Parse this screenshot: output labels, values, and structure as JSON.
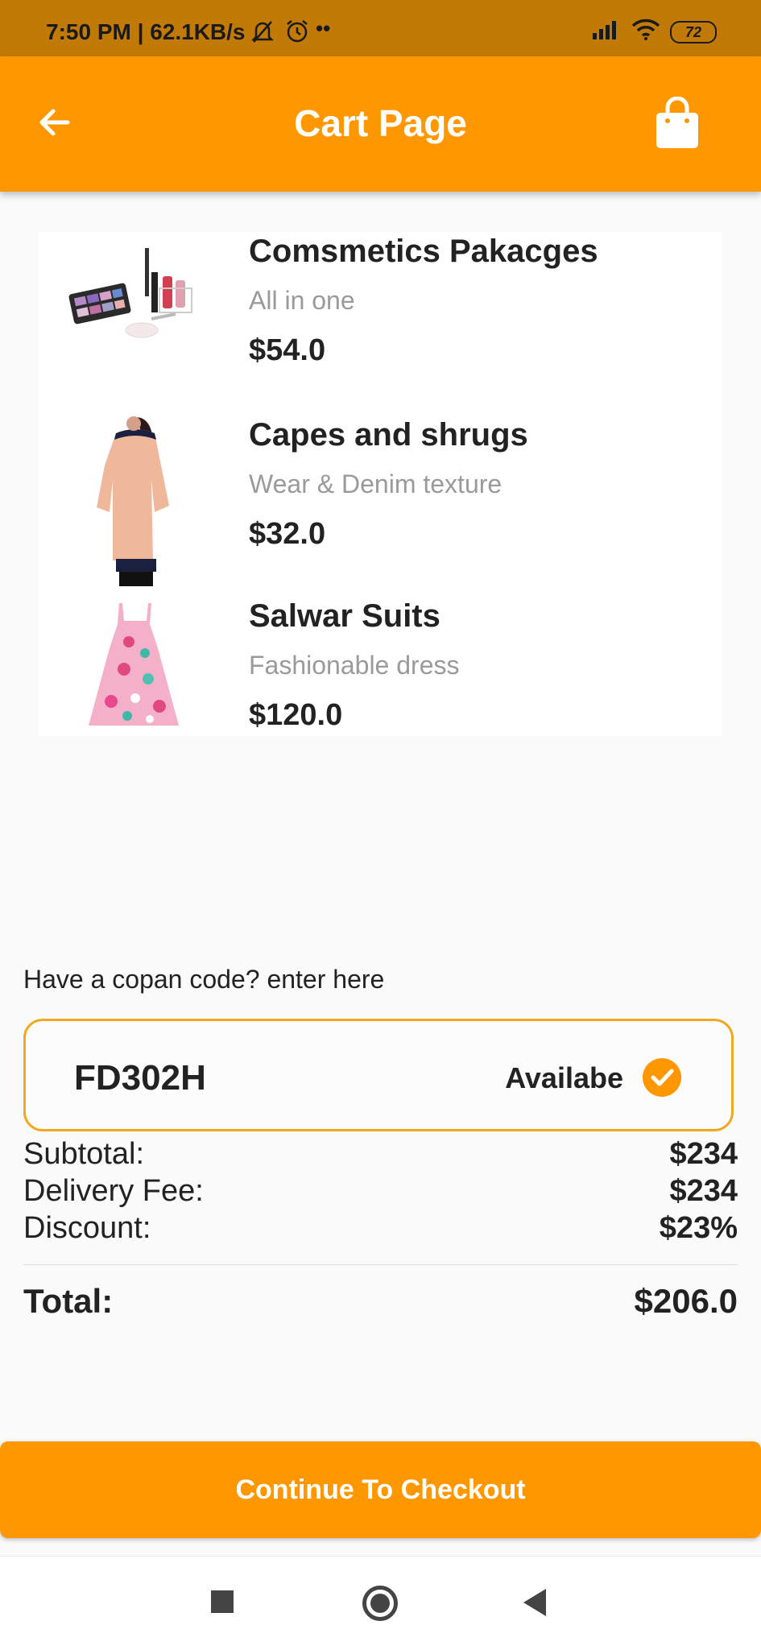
{
  "status_bar": {
    "time_speed": "7:50 PM | 62.1KB/s",
    "battery": "72"
  },
  "app_bar": {
    "title": "Cart Page"
  },
  "cart_items": [
    {
      "name": "Comsmetics Pakacges",
      "subtitle": "All in one",
      "price": "$54.0"
    },
    {
      "name": "Capes and shrugs",
      "subtitle": "Wear & Denim texture",
      "price": "$32.0"
    },
    {
      "name": "Salwar Suits",
      "subtitle": "Fashionable dress",
      "price": "$120.0"
    }
  ],
  "coupon": {
    "prompt": "Have a copan code? enter here",
    "code": "FD302H",
    "status": "Availabe"
  },
  "summary": {
    "subtotal_label": "Subtotal:",
    "subtotal_value": "$234",
    "delivery_label": "Delivery Fee:",
    "delivery_value": "$234",
    "discount_label": "Discount:",
    "discount_value": "$23%",
    "total_label": "Total:",
    "total_value": "$206.0"
  },
  "checkout_button": "Continue To Checkout",
  "colors": {
    "accent": "#ff9800",
    "status_bar": "#c17a06",
    "coupon_border": "#f0a91e"
  }
}
